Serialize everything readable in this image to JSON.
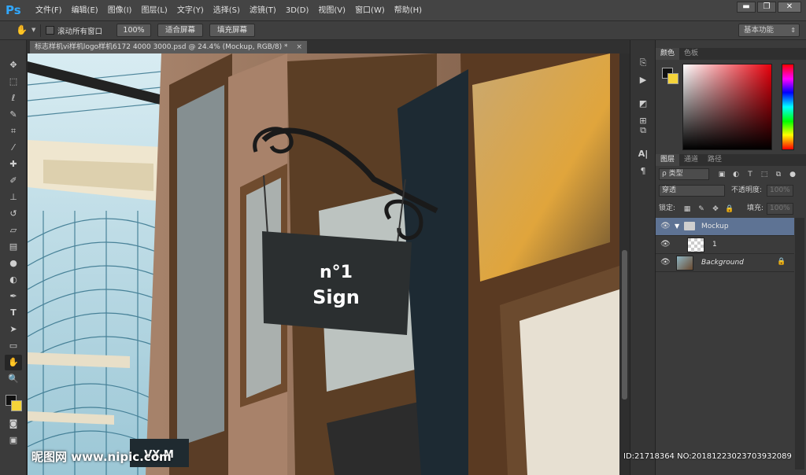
{
  "app": {
    "logo": "Ps"
  },
  "menu": [
    "文件(F)",
    "编辑(E)",
    "图像(I)",
    "图层(L)",
    "文字(Y)",
    "选择(S)",
    "滤镜(T)",
    "3D(D)",
    "视图(V)",
    "窗口(W)",
    "帮助(H)"
  ],
  "window_controls": {
    "minimize": "▬",
    "restore": "❐",
    "close": "✕"
  },
  "options": {
    "scroll_all_label": "滚动所有窗口",
    "zoom_100": "100%",
    "fit_screen": "适合屏幕",
    "fill_screen": "填充屏幕",
    "workspace": "基本功能"
  },
  "document": {
    "tab_title": "标志样机vi样机logo样机6172 4000 3000.psd @ 24.4% (Mockup, RGB/8) *",
    "close": "×"
  },
  "canvas": {
    "sign_line1": "n°1",
    "sign_line2": "Sign",
    "store_sign": "VX M"
  },
  "panels": {
    "color_tabs": [
      "颜色",
      "色板"
    ],
    "layer_tabs": [
      "图层",
      "通道",
      "路径"
    ],
    "filter_kind": "ρ 类型",
    "blend_mode": "穿透",
    "opacity_label": "不透明度:",
    "opacity_value": "100%",
    "lock_label": "锁定:",
    "fill_label": "填充:",
    "fill_value": "100%",
    "layers": [
      {
        "name": "Mockup",
        "type": "group",
        "selected": true
      },
      {
        "name": "1",
        "type": "smart-object",
        "selected": false
      },
      {
        "name": "Background",
        "type": "image",
        "selected": false,
        "locked": true
      }
    ]
  },
  "icons": {
    "tools": [
      "move-icon",
      "marquee-icon",
      "lasso-icon",
      "quick-select-icon",
      "crop-icon",
      "eyedropper-icon",
      "healing-brush-icon",
      "brush-icon",
      "clone-stamp-icon",
      "history-brush-icon",
      "eraser-icon",
      "gradient-icon",
      "blur-icon",
      "dodge-icon",
      "pen-icon",
      "type-icon",
      "path-select-icon",
      "shape-icon",
      "hand-icon",
      "zoom-icon"
    ]
  },
  "colors": {
    "accent": "#31a8ff",
    "selected_layer": "#5e7394",
    "foreground": "#111111",
    "background": "#f5d43a"
  },
  "watermark": {
    "left": "昵图网 www.nipic.com",
    "right": "ID:21718364 NO:20181223023703932089"
  }
}
